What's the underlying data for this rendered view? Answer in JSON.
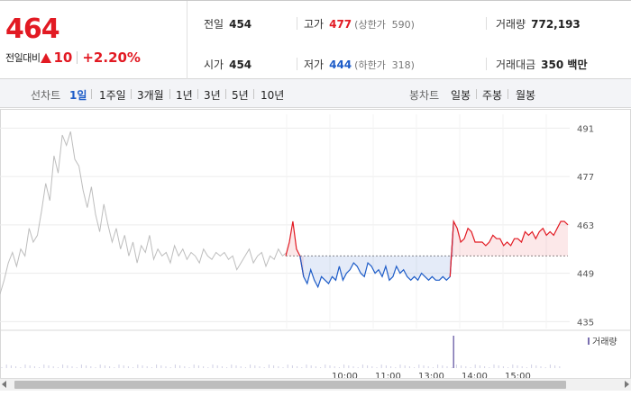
{
  "quote": {
    "price": "464",
    "change_label": "전일대비",
    "change_icon": "up-triangle-icon",
    "change_value": "10",
    "change_rate": "+2.20%",
    "prev_close_label": "전일",
    "prev_close": "454",
    "open_label": "시가",
    "open": "454",
    "high_label": "고가",
    "high": "477",
    "upper_limit_label": "(상한가",
    "upper_limit": "590)",
    "low_label": "저가",
    "low": "444",
    "lower_limit_label": "(하한가",
    "lower_limit": "318)",
    "volume_label": "거래량",
    "volume": "772,193",
    "amount_label": "거래대금",
    "amount": "350 백만",
    "colors": {
      "up": "#e21a23",
      "down": "#1d5cc8"
    }
  },
  "period_tabs": {
    "line_title": "선차트",
    "line_items": [
      "1일",
      "1주일",
      "3개월",
      "1년",
      "3년",
      "5년",
      "10년"
    ],
    "active": "1일",
    "candle_title": "봉차트",
    "candle_items": [
      "일봉",
      "주봉",
      "월봉"
    ]
  },
  "chart_data": {
    "type": "line",
    "title": "",
    "ylim": [
      433,
      495
    ],
    "yticks": [
      491,
      477,
      463,
      449,
      435
    ],
    "baseline": 454,
    "x_labels": [
      "10:00",
      "11:00",
      "13:00",
      "14:00",
      "15:00"
    ],
    "series": [
      {
        "values": [
          443,
          447,
          452,
          455,
          451,
          456,
          454,
          462,
          458,
          460,
          467,
          475,
          470,
          483,
          478,
          489,
          486,
          490,
          482,
          480,
          473,
          468,
          474,
          466,
          461,
          469,
          463,
          458,
          462,
          456,
          460,
          454,
          458,
          452,
          457,
          455,
          460,
          453,
          456,
          454,
          455,
          452,
          457,
          454,
          456,
          453,
          455,
          454,
          452,
          456,
          454,
          453,
          455,
          454,
          455,
          453,
          454,
          450,
          452,
          454,
          456,
          452,
          454,
          455,
          451,
          454,
          453,
          456,
          454,
          455
        ]
      },
      {
        "values": [
          454,
          458,
          464,
          456,
          454,
          448,
          446,
          450,
          447,
          445,
          448,
          447,
          446,
          448,
          447,
          451,
          447,
          449,
          450,
          452,
          451,
          449,
          448,
          452,
          451,
          449,
          450,
          448,
          451,
          447,
          448,
          451,
          449,
          450,
          448,
          447,
          448,
          447,
          449,
          448,
          447,
          448,
          447,
          447,
          448,
          447,
          448,
          464,
          462,
          458,
          459,
          462,
          461,
          458,
          458,
          458,
          457,
          458,
          460,
          459,
          459,
          457,
          458,
          457,
          459,
          459,
          458,
          461,
          460,
          461,
          459,
          461,
          462,
          460,
          461,
          460,
          462,
          464,
          464,
          463
        ]
      }
    ],
    "volume": {
      "legend": "거래량",
      "spike_index": 47
    }
  },
  "scrollbar": {
    "left_icon": "scroll-left-icon",
    "right_icon": "scroll-right-icon"
  }
}
